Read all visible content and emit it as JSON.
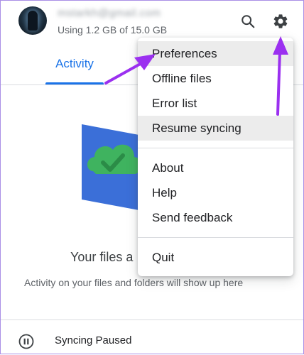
{
  "account": {
    "email": "mstarkh@gmail.com",
    "usage": "Using 1.2 GB of 15.0 GB"
  },
  "header": {
    "search_icon": "search-icon",
    "settings_icon": "gear-icon"
  },
  "tabs": [
    {
      "label": "Activity",
      "active": true
    }
  ],
  "menu": {
    "groups": [
      [
        "Preferences",
        "Offline files",
        "Error list",
        "Resume syncing"
      ],
      [
        "About",
        "Help",
        "Send feedback"
      ],
      [
        "Quit"
      ]
    ],
    "highlighted": [
      "Preferences",
      "Resume syncing"
    ]
  },
  "empty_state": {
    "title": "Your files a",
    "subtitle": "Activity on your files and folders will show up here"
  },
  "footer": {
    "status": "Syncing Paused",
    "status_icon": "pause-circle-icon"
  },
  "colors": {
    "accent": "#1a73e8",
    "annotation_arrow": "#9b30f0",
    "illustration_blue": "#3b6fd8",
    "illustration_green": "#3fb35f"
  }
}
